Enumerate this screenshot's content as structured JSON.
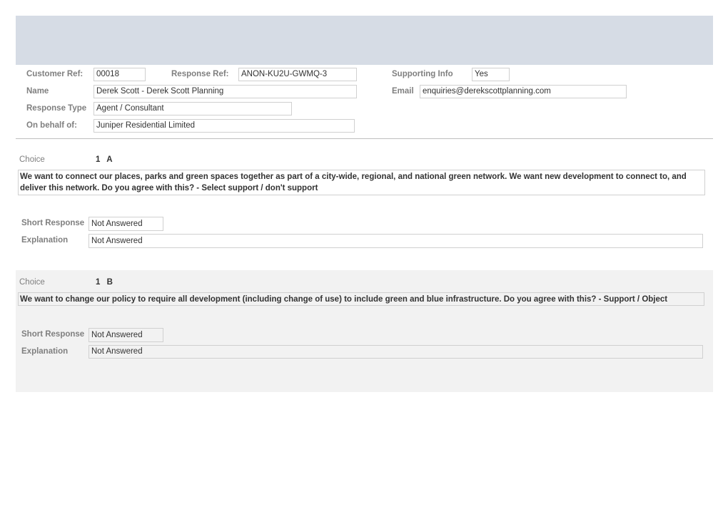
{
  "header": {
    "customer_ref_label": "Customer Ref:",
    "customer_ref_value": "00018",
    "response_ref_label": "Response Ref:",
    "response_ref_value": "ANON-KU2U-GWMQ-3",
    "supporting_info_label": "Supporting Info",
    "supporting_info_value": "Yes",
    "name_label": "Name",
    "name_value": "Derek Scott - Derek Scott Planning",
    "email_label": "Email",
    "email_value": "enquiries@derekscottplanning.com",
    "response_type_label": "Response Type",
    "response_type_value": "Agent / Consultant",
    "on_behalf_label": "On behalf of:",
    "on_behalf_value": "Juniper Residential Limited"
  },
  "choices": [
    {
      "label": "Choice",
      "number": "1",
      "letter": "A",
      "question": "We want to connect our places, parks and green spaces together as part of a city-wide, regional, and national green network. We want new development to connect to, and deliver this network. Do you agree with this? - Select support / don't support",
      "short_response_label": "Short Response",
      "short_response_value": "Not Answered",
      "explanation_label": "Explanation",
      "explanation_value": "Not Answered"
    },
    {
      "label": "Choice",
      "number": "1",
      "letter": "B",
      "question": "We want to change our policy to require all development (including change of use) to include green and blue infrastructure. Do you agree with this? - Support / Object",
      "short_response_label": "Short Response",
      "short_response_value": "Not Answered",
      "explanation_label": "Explanation",
      "explanation_value": "Not Answered"
    }
  ]
}
